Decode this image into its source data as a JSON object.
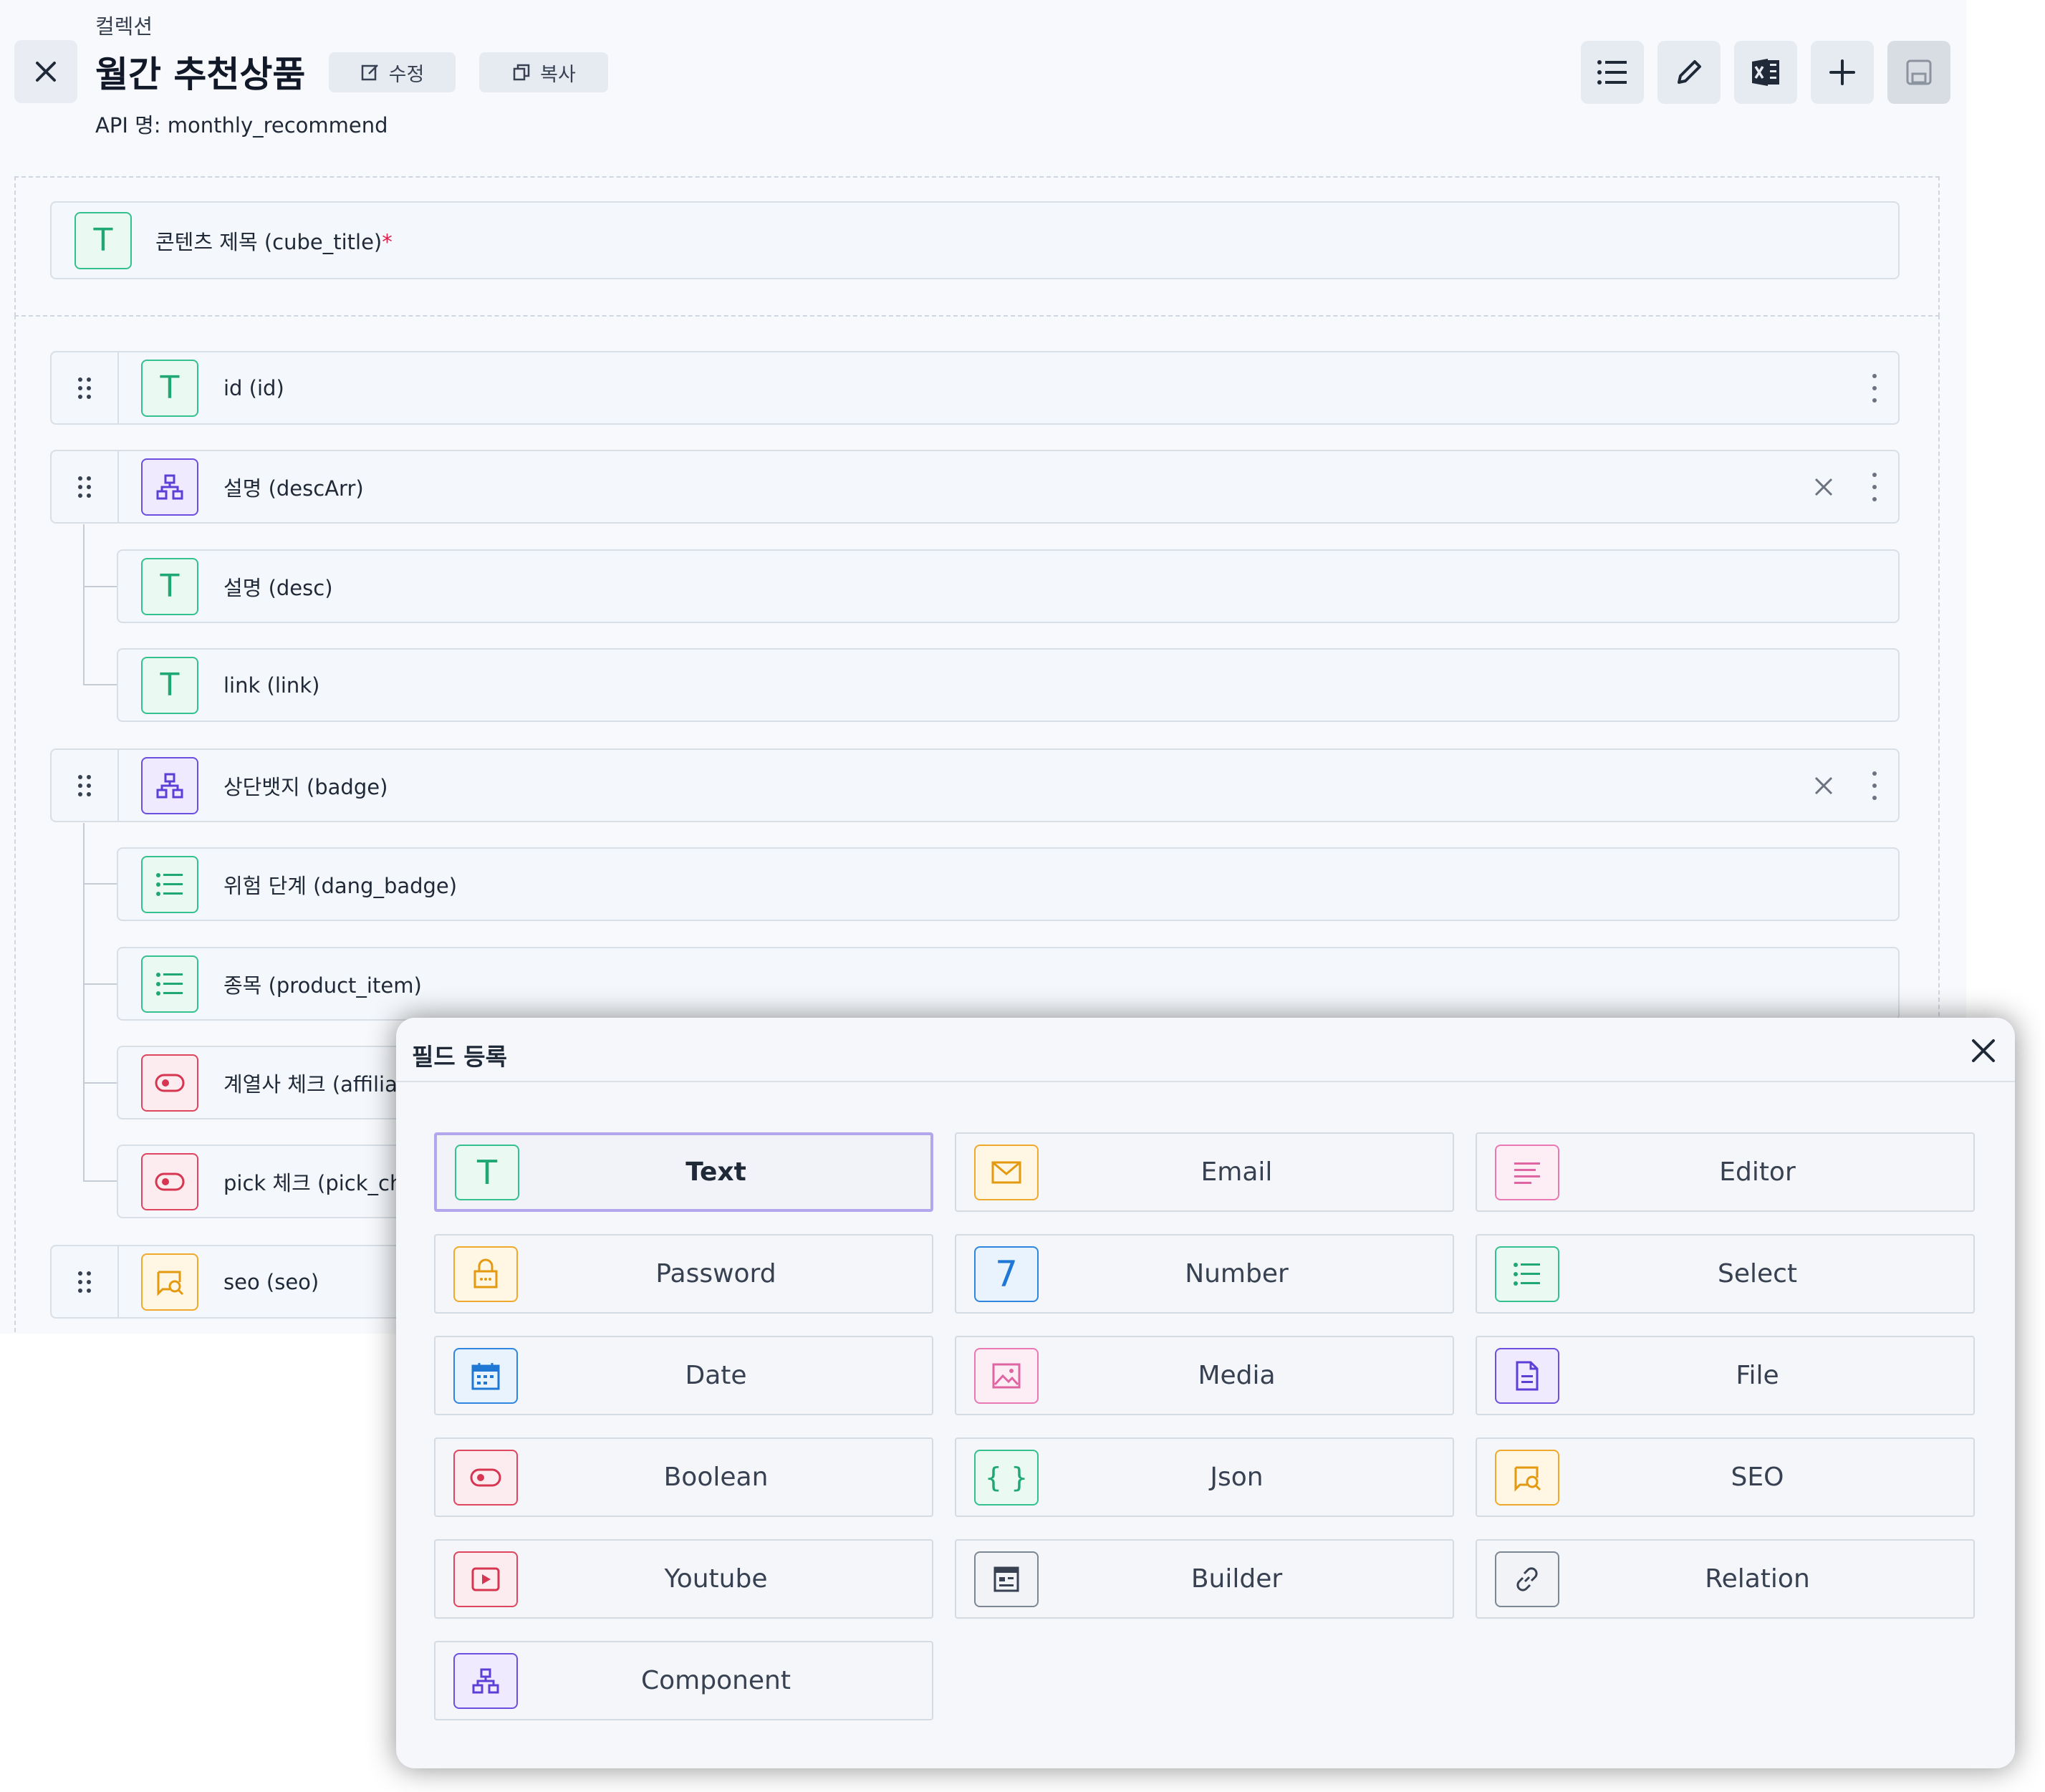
{
  "header": {
    "breadcrumb": "컬렉션",
    "title": "월간 추천상품",
    "api_name": "API 명: monthly_recommend",
    "edit_label": "수정",
    "copy_label": "복사"
  },
  "toolbar": {
    "icons": [
      "list-icon",
      "pencil-icon",
      "excel-icon",
      "plus-icon",
      "save-icon"
    ]
  },
  "title_field": {
    "label": "콘텐츠 제목 (cube_title)",
    "required_mark": "*"
  },
  "fields": {
    "id": "id (id)",
    "descArr": "설명 (descArr)",
    "desc": "설명 (desc)",
    "link": "link (link)",
    "badge": "상단뱃지 (badge)",
    "dang_badge": "위험 단계 (dang_badge)",
    "product_item": "종목 (product_item)",
    "affiliate": "계열사 체크 (affiliat",
    "pick": "pick 체크 (pick_ch",
    "seo": "seo (seo)"
  },
  "modal": {
    "title": "필드 등록",
    "options": {
      "text": "Text",
      "email": "Email",
      "editor": "Editor",
      "password": "Password",
      "number": "Number",
      "number_glyph": "7",
      "select": "Select",
      "date": "Date",
      "media": "Media",
      "file": "File",
      "boolean": "Boolean",
      "json": "Json",
      "json_glyph": "{ }",
      "seo": "SEO",
      "youtube": "Youtube",
      "builder": "Builder",
      "relation": "Relation",
      "component": "Component"
    },
    "selected": "Text"
  },
  "colors": {
    "green": "#34c08f",
    "purple": "#6d4fe0",
    "red": "#e0455f",
    "orange": "#f0a92d",
    "blue": "#2f86de",
    "pink": "#e978b3",
    "selected_border": "#b4a6ec"
  },
  "glyphs": {
    "text": "T"
  }
}
